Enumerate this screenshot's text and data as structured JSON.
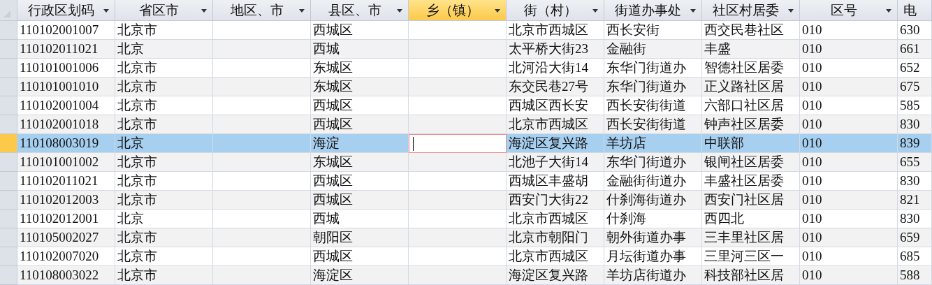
{
  "table": {
    "columns": [
      {
        "label": "行政区划码",
        "selected": false
      },
      {
        "label": "省区市",
        "selected": false
      },
      {
        "label": "地区、市",
        "selected": false
      },
      {
        "label": "县区、市",
        "selected": false
      },
      {
        "label": "乡（镇）",
        "selected": true
      },
      {
        "label": "街（村）",
        "selected": false
      },
      {
        "label": "街道办事处",
        "selected": false
      },
      {
        "label": "社区村居委",
        "selected": false
      },
      {
        "label": "区号",
        "selected": false
      },
      {
        "label": "电",
        "selected": false
      }
    ],
    "rows": [
      {
        "selected": false,
        "cells": [
          "110102001007",
          "北京市",
          null,
          "西城区",
          null,
          "北京市西城区",
          "西长安街",
          "西交民巷社区",
          "010",
          "630"
        ]
      },
      {
        "selected": false,
        "cells": [
          "110102011021",
          "北京",
          null,
          "西城",
          null,
          "太平桥大街23",
          "金融街",
          "丰盛",
          "010",
          "661"
        ]
      },
      {
        "selected": false,
        "cells": [
          "110101001006",
          "北京市",
          null,
          "东城区",
          null,
          "北河沿大街14",
          "东华门街道办",
          "智德社区居委",
          "010",
          "652"
        ]
      },
      {
        "selected": false,
        "cells": [
          "110101001010",
          "北京市",
          null,
          "东城区",
          null,
          "东交民巷27号",
          "东华门街道办",
          "正义路社区居",
          "010",
          "675"
        ]
      },
      {
        "selected": false,
        "cells": [
          "110102001004",
          "北京市",
          null,
          "西城区",
          null,
          "西城区西长安",
          "西长安街街道",
          "六部口社区居",
          "010",
          "585"
        ]
      },
      {
        "selected": false,
        "cells": [
          "110102001018",
          "北京市",
          null,
          "西城区",
          null,
          "北京市西城区",
          "西长安街街道",
          "钟声社区居委",
          "010",
          "830"
        ]
      },
      {
        "selected": true,
        "cells": [
          "110108003019",
          "北京",
          null,
          "海淀",
          null,
          "海淀区复兴路",
          "羊坊店",
          "中联部",
          "010",
          "839"
        ]
      },
      {
        "selected": false,
        "cells": [
          "110101001002",
          "北京市",
          null,
          "东城区",
          null,
          "北池子大街14",
          "东华门街道办",
          "银闸社区居委",
          "010",
          "655"
        ]
      },
      {
        "selected": false,
        "cells": [
          "110102011021",
          "北京市",
          null,
          "西城区",
          null,
          "西城区丰盛胡",
          "金融街街道办",
          "丰盛社区居委",
          "010",
          "830"
        ]
      },
      {
        "selected": false,
        "cells": [
          "110102012003",
          "北京市",
          null,
          "西城区",
          null,
          "西安门大街22",
          "什刹海街道办",
          "西安门社区居",
          "010",
          "821"
        ]
      },
      {
        "selected": false,
        "cells": [
          "110102012001",
          "北京",
          null,
          "西城",
          null,
          "北京市西城区",
          "什刹海",
          "西四北",
          "010",
          "830"
        ]
      },
      {
        "selected": false,
        "cells": [
          "110105002027",
          "北京市",
          null,
          "朝阳区",
          null,
          "北京市朝阳门",
          "朝外街道办事",
          "三丰里社区居",
          "010",
          "659"
        ]
      },
      {
        "selected": false,
        "cells": [
          "110102007020",
          "北京市",
          null,
          "西城区",
          null,
          "北京市西城区",
          "月坛街道办事",
          "三里河三区一",
          "010",
          "685"
        ]
      },
      {
        "selected": false,
        "cells": [
          "110108003022",
          "北京市",
          null,
          "海淀区",
          null,
          "海淀区复兴路",
          "羊坊店街道办",
          "科技部社区居",
          "010",
          "588"
        ]
      }
    ]
  }
}
